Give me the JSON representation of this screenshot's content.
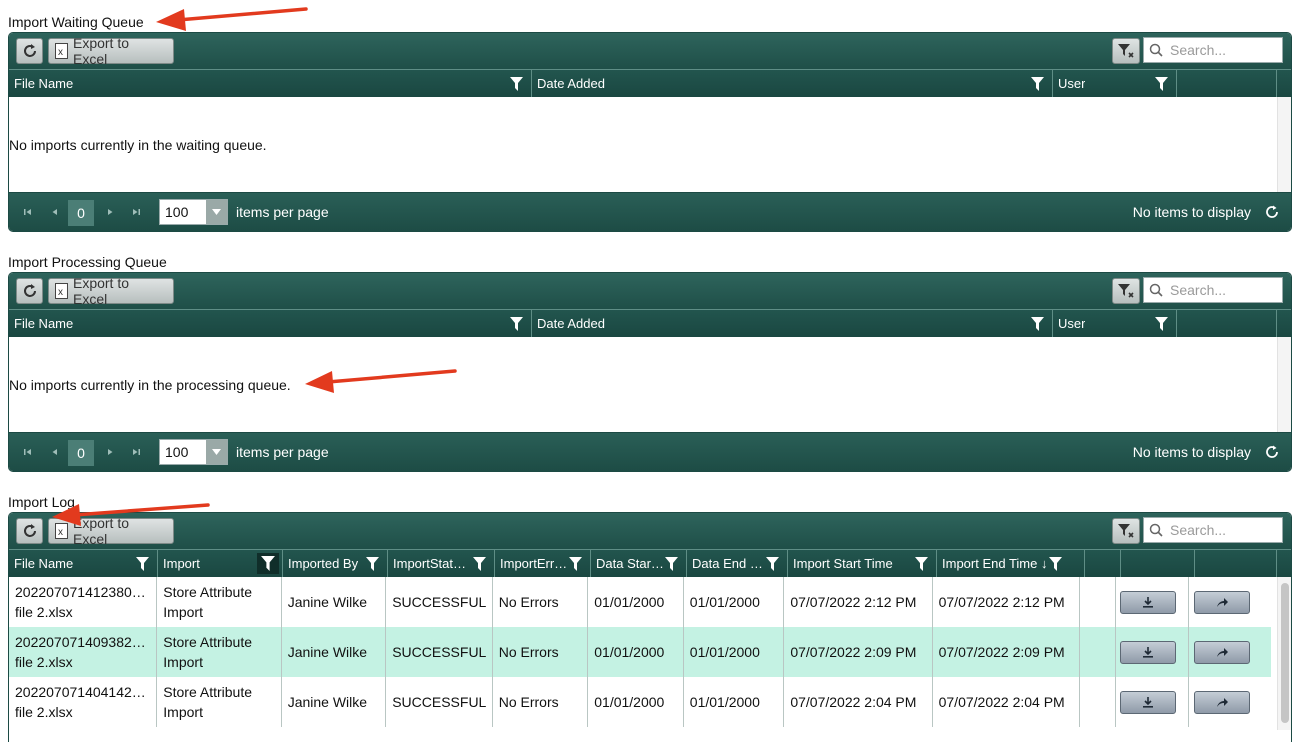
{
  "toolbar": {
    "export_label": "Export to Excel",
    "search_placeholder": "Search..."
  },
  "waiting": {
    "title": "Import Waiting Queue",
    "columns": [
      "File Name",
      "Date Added",
      "User"
    ],
    "empty_message": "No imports currently in the waiting queue.",
    "page": "0",
    "page_size": "100",
    "page_size_label": "items per page",
    "status": "No items to display"
  },
  "processing": {
    "title": "Import Processing Queue",
    "columns": [
      "File Name",
      "Date Added",
      "User"
    ],
    "empty_message": "No imports currently in the processing queue.",
    "page": "0",
    "page_size": "100",
    "page_size_label": "items per page",
    "status": "No items to display"
  },
  "log": {
    "title": "Import Log",
    "columns": [
      "File Name",
      "Import",
      "Imported By",
      "ImportStat…",
      "ImportErr…",
      "Data Star…",
      "Data End …",
      "Import Start Time",
      "Import End Time ↓"
    ],
    "rows": [
      {
        "file_line1": "202207071412380…",
        "file_line2": "file 2.xlsx",
        "import_line1": "Store Attribute",
        "import_line2": "Import",
        "by": "Janine Wilke",
        "status": "SUCCESSFUL",
        "errors": "No Errors",
        "data_start": "01/01/2000",
        "data_end": "01/01/2000",
        "start": "07/07/2022 2:12 PM",
        "end": "07/07/2022 2:12 PM"
      },
      {
        "file_line1": "202207071409382…",
        "file_line2": "file 2.xlsx",
        "import_line1": "Store Attribute",
        "import_line2": "Import",
        "by": "Janine Wilke",
        "status": "SUCCESSFUL",
        "errors": "No Errors",
        "data_start": "01/01/2000",
        "data_end": "01/01/2000",
        "start": "07/07/2022 2:09 PM",
        "end": "07/07/2022 2:09 PM"
      },
      {
        "file_line1": "202207071404142…",
        "file_line2": "file 2.xlsx",
        "import_line1": "Store Attribute",
        "import_line2": "Import",
        "by": "Janine Wilke",
        "status": "SUCCESSFUL",
        "errors": "No Errors",
        "data_start": "01/01/2000",
        "data_end": "01/01/2000",
        "start": "07/07/2022 2:04 PM",
        "end": "07/07/2022 2:04 PM"
      }
    ]
  },
  "colors": {
    "header": "#1f4f48",
    "row_highlight": "#c4f2e3",
    "annotation_arrow": "#e23a1e"
  },
  "icons": [
    "refresh-icon",
    "excel-icon",
    "filter-clear-icon",
    "search-icon",
    "filter-icon",
    "first-page-icon",
    "prev-page-icon",
    "next-page-icon",
    "last-page-icon",
    "dropdown-arrow-icon",
    "reload-icon",
    "download-icon",
    "share-icon"
  ]
}
